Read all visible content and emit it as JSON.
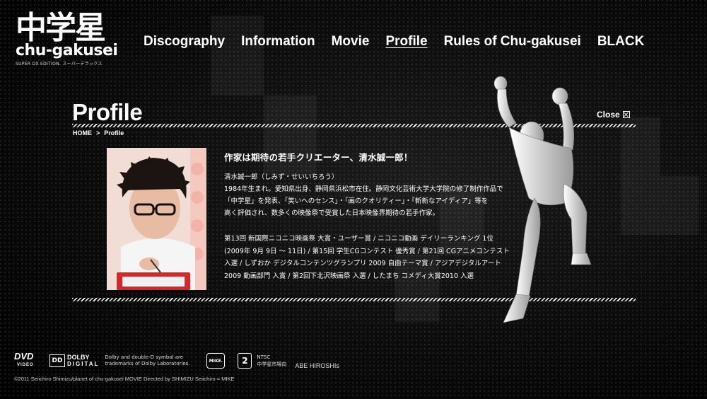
{
  "brand": {
    "logo_kanji": "中学星",
    "logo_roman": "chu-gakusei",
    "logo_sub": "SUPER DX EDITION. スーパーデラックス"
  },
  "nav": {
    "items": [
      {
        "label": "Discography",
        "active": false
      },
      {
        "label": "Information",
        "active": false
      },
      {
        "label": "Movie",
        "active": false
      },
      {
        "label": "Profile",
        "active": true
      },
      {
        "label": "Rules of Chu-gakusei",
        "active": false
      },
      {
        "label": "BLACK",
        "active": false
      }
    ]
  },
  "panel": {
    "title": "Profile",
    "close_label": "Close",
    "breadcrumb": {
      "home": "HOME",
      "separator": ">",
      "current": "Profile"
    }
  },
  "profile": {
    "headline": "作家は期待の若手クリエーター、清水誠一郎！",
    "name": "清水誠一郎（しみず・せいいちろう）",
    "bio": [
      "1984年生まれ。愛知県出身、静岡県浜松市在住。静岡文化芸術大学大学院の修了制作作品で",
      "「中学星」を発表、「笑いへのセンス」・「画のクオリティー」・「斬新なアイディア」等を",
      "高く評価され、数多くの映像祭で受賞した日本映像界期待の若手作家。"
    ],
    "awards": [
      "第13回 新国際ニコニコ映画祭 大賞・ユーザー賞 / ニコニコ動画 デイリーランキング 1位",
      "(2009年 9月 9日 〜 11日) / 第15回 学生CGコンテスト 優秀賞 / 第21回 CGアニメコンテスト",
      "入選 / しずおか デジタルコンテンツグランプリ 2009 自由テーマ賞 / アジアデジタルアート",
      "2009 動画部門 入賞 / 第2回下北沢映画祭 入選 / したまち コメディ大賞2010 入選"
    ]
  },
  "footer": {
    "dvd_label": "DVD",
    "dvd_sub": "VIDEO",
    "dolby_label": "DOLBY",
    "dolby_sub": "DIGITAL",
    "dolby_note": "Dolby and double-D symbol are trademarks of Dolby Laboratories.",
    "mike_label": "MIKE.",
    "rating": "2",
    "ntsc_line1": "NTSC",
    "ntsc_line2": "中学星市場向",
    "credit": "ABE HIROSHIs",
    "copyright": "©2011 Seiichiro Shimizu/planet of chu-gakusei  MOVIE Directed by SHIMIZU Seiichiro = MIKE"
  },
  "colors": {
    "background": "#000000",
    "text": "#ffffff",
    "photo_bg": "#f0dcd6",
    "accent_red": "#d9262a"
  }
}
